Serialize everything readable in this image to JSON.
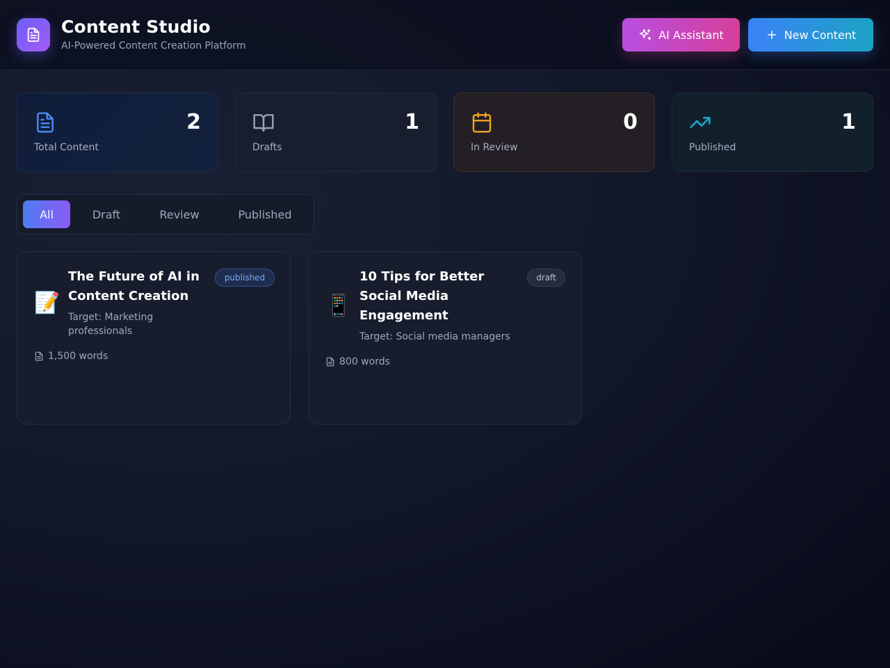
{
  "header": {
    "title": "Content Studio",
    "subtitle": "AI-Powered Content Creation Platform",
    "ai_button_label": "AI Assistant",
    "new_button_label": "New Content"
  },
  "stats": [
    {
      "label": "Total Content",
      "value": "2",
      "icon": "document-icon",
      "color": "#4b8df8"
    },
    {
      "label": "Drafts",
      "value": "1",
      "icon": "book-open-icon",
      "color": "#9aa2b8"
    },
    {
      "label": "In Review",
      "value": "0",
      "icon": "calendar-icon",
      "color": "#f5a623"
    },
    {
      "label": "Published",
      "value": "1",
      "icon": "trending-up-icon",
      "color": "#1ba3c4"
    }
  ],
  "tabs": [
    {
      "label": "All",
      "active": true
    },
    {
      "label": "Draft",
      "active": false
    },
    {
      "label": "Review",
      "active": false
    },
    {
      "label": "Published",
      "active": false
    }
  ],
  "cards": [
    {
      "emoji": "📝",
      "title": "The Future of AI in Content Creation",
      "target": "Target: Marketing professionals",
      "status": "published",
      "words": "1,500 words"
    },
    {
      "emoji": "📱",
      "title": "10 Tips for Better Social Media Engagement",
      "target": "Target: Social media managers",
      "status": "draft",
      "words": "800 words"
    }
  ]
}
